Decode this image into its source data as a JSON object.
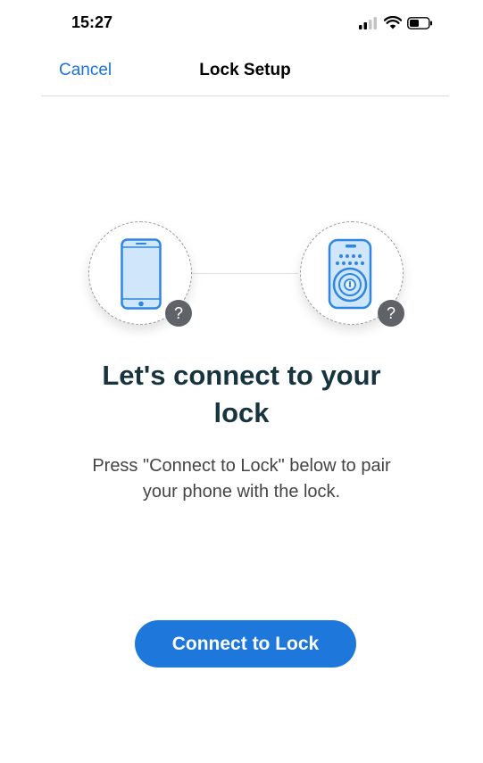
{
  "status_bar": {
    "time": "15:27",
    "icons": [
      "cellular-signal-icon",
      "wifi-icon",
      "battery-icon"
    ]
  },
  "nav": {
    "cancel_label": "Cancel",
    "title": "Lock Setup"
  },
  "illustration": {
    "phone_help": "?",
    "lock_help": "?"
  },
  "content": {
    "headline_line1": "Let's connect to your",
    "headline_line2": "lock",
    "subtext_line1": "Press \"Connect to Lock\" below to pair",
    "subtext_line2": "your phone with the lock."
  },
  "actions": {
    "primary_label": "Connect to Lock"
  },
  "colors": {
    "accent": "#1e78dc",
    "headline": "#17343f",
    "device_fill": "#cfe6fb",
    "device_stroke": "#2f86de"
  }
}
